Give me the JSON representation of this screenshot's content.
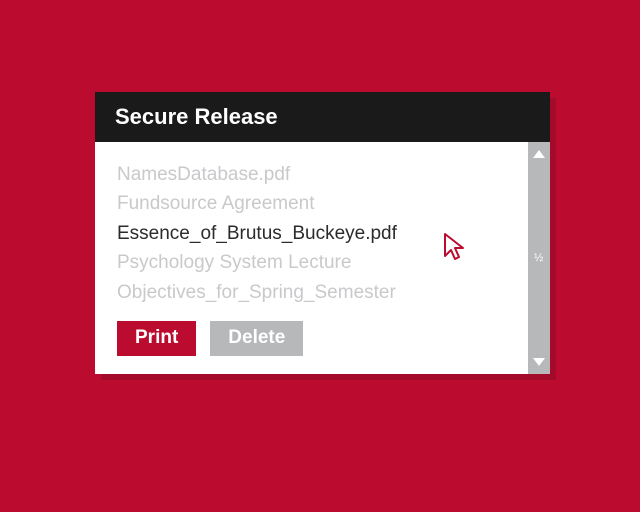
{
  "window": {
    "title": "Secure Release"
  },
  "files": [
    {
      "name": "NamesDatabase.pdf",
      "selected": false
    },
    {
      "name": "Fundsource Agreement",
      "selected": false
    },
    {
      "name": "Essence_of_Brutus_Buckeye.pdf",
      "selected": true
    },
    {
      "name": "Psychology System Lecture",
      "selected": false
    },
    {
      "name": "Objectives_for_Spring_Semester",
      "selected": false
    }
  ],
  "buttons": {
    "print": "Print",
    "delete": "Delete"
  },
  "scroll": {
    "indicator": "½"
  },
  "colors": {
    "brand_red": "#bb0c2f",
    "grey": "#b6b8ba",
    "titlebar": "#1a1a1a"
  }
}
